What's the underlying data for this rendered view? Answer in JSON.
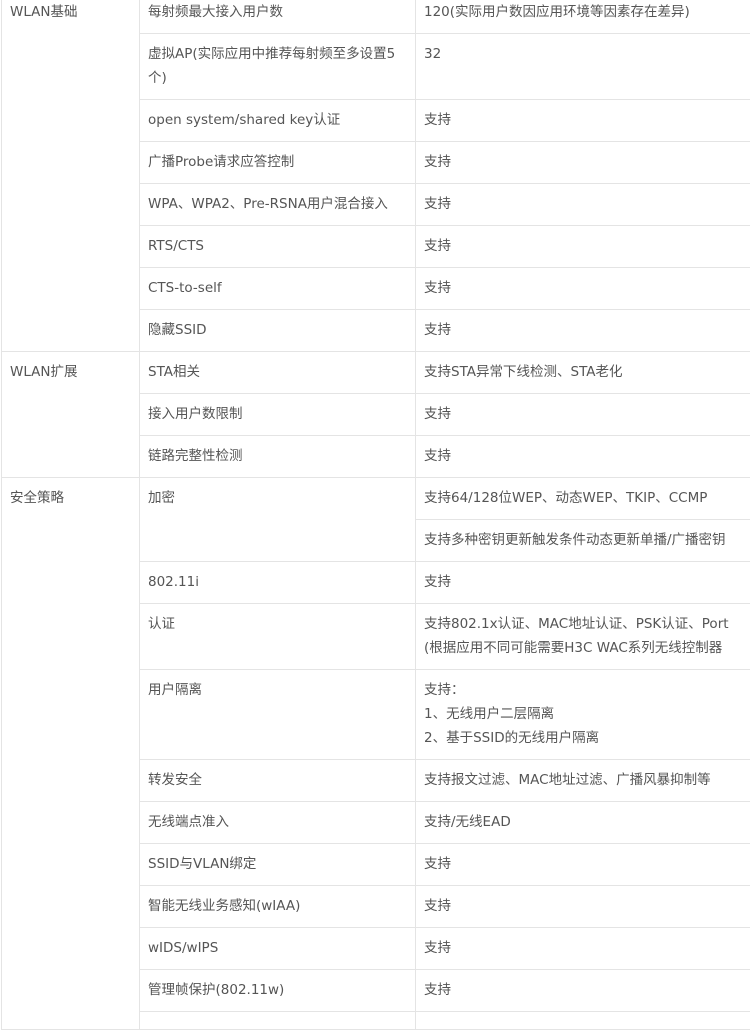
{
  "groups": [
    {
      "category": "WLAN基础",
      "rows": [
        {
          "feature": "每射频最大接入用户数",
          "values": [
            "120(实际用户数因应用环境等因素存在差异)"
          ]
        },
        {
          "feature": "虚拟AP(实际应用中推荐每射频至多设置5个)",
          "values": [
            "32"
          ]
        },
        {
          "feature": "open system/shared key认证",
          "values": [
            "支持"
          ]
        },
        {
          "feature": "广播Probe请求应答控制",
          "values": [
            "支持"
          ]
        },
        {
          "feature": "WPA、WPA2、Pre-RSNA用户混合接入",
          "values": [
            "支持"
          ]
        },
        {
          "feature": "RTS/CTS",
          "values": [
            "支持"
          ]
        },
        {
          "feature": "CTS-to-self",
          "values": [
            "支持"
          ]
        },
        {
          "feature": "隐藏SSID",
          "values": [
            "支持"
          ]
        }
      ]
    },
    {
      "category": "WLAN扩展",
      "rows": [
        {
          "feature": "STA相关",
          "values": [
            "支持STA异常下线检测、STA老化"
          ]
        },
        {
          "feature": "接入用户数限制",
          "values": [
            "支持"
          ]
        },
        {
          "feature": "链路完整性检测",
          "values": [
            "支持"
          ]
        }
      ]
    },
    {
      "category": "安全策略",
      "rows": [
        {
          "feature": "加密",
          "values": [
            "支持64/128位WEP、动态WEP、TKIP、CCMP",
            "支持多种密钥更新触发条件动态更新单播/广播密钥"
          ]
        },
        {
          "feature": "802.11i",
          "values": [
            "支持"
          ]
        },
        {
          "feature": "认证",
          "values": [
            "支持802.1x认证、MAC地址认证、PSK认证、Port",
            "(根据应用不同可能需要H3C WAC系列无线控制器"
          ]
        },
        {
          "feature": "用户隔离",
          "values": [
            "支持：",
            "1、无线用户二层隔离",
            "2、基于SSID的无线用户隔离"
          ]
        },
        {
          "feature": "转发安全",
          "values": [
            "支持报文过滤、MAC地址过滤、广播风暴抑制等"
          ]
        },
        {
          "feature": "无线端点准入",
          "values": [
            "支持/无线EAD"
          ]
        },
        {
          "feature": "SSID与VLAN绑定",
          "values": [
            "支持"
          ]
        },
        {
          "feature": "智能无线业务感知(wIAA)",
          "values": [
            "支持"
          ]
        },
        {
          "feature": "wIDS/wIPS",
          "values": [
            "支持"
          ]
        },
        {
          "feature": "管理帧保护(802.11w)",
          "values": [
            "支持"
          ]
        },
        {
          "feature": "",
          "values": [
            ""
          ]
        }
      ]
    }
  ]
}
